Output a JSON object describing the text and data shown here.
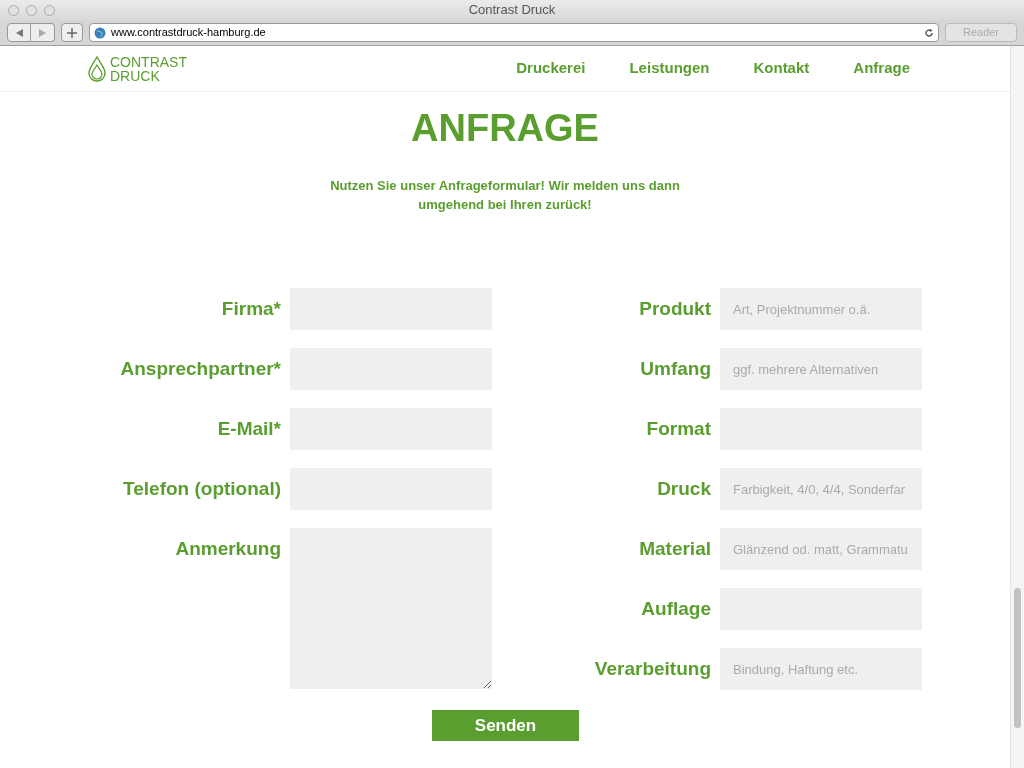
{
  "window": {
    "title": "Contrast Druck"
  },
  "toolbar": {
    "url": "www.contrastdruck-hamburg.de",
    "reader": "Reader"
  },
  "logo": {
    "line_1": "CONTRAST",
    "line_2": "DRUCK"
  },
  "nav": [
    {
      "label": "Druckerei",
      "selected": false
    },
    {
      "label": "Leistungen",
      "selected": false
    },
    {
      "label": "Kontakt",
      "selected": false
    },
    {
      "label": "Anfrage",
      "selected": false
    }
  ],
  "heading": "ANFRAGE",
  "intro": "Nutzen Sie unser Anfrageformular! Wir melden uns dann umgehend bei Ihren zurück!",
  "left_fields": [
    {
      "label": "Firma*",
      "kind": "input"
    },
    {
      "label": "Ansprechpartner*",
      "kind": "input"
    },
    {
      "label": "E-Mail*",
      "kind": "input"
    },
    {
      "label": "Telefon (optional)",
      "kind": "input"
    },
    {
      "label": "Anmerkung",
      "kind": "textarea"
    }
  ],
  "right_fields": [
    {
      "label": "Produkt",
      "placeholder": "Art, Projektnummer o.ä."
    },
    {
      "label": "Umfang",
      "placeholder": "ggf. mehrere Alternativen"
    },
    {
      "label": "Format"
    },
    {
      "label": "Druck",
      "placeholder": "Farbigkeit, 4/0, 4/4, Sonderfar"
    },
    {
      "label": "Material",
      "placeholder": "Glänzend od. matt, Grammatu"
    },
    {
      "label": "Auflage"
    },
    {
      "label": "Verarbeitung",
      "placeholder": "Bindung, Haftung etc."
    }
  ],
  "submit": "Senden"
}
